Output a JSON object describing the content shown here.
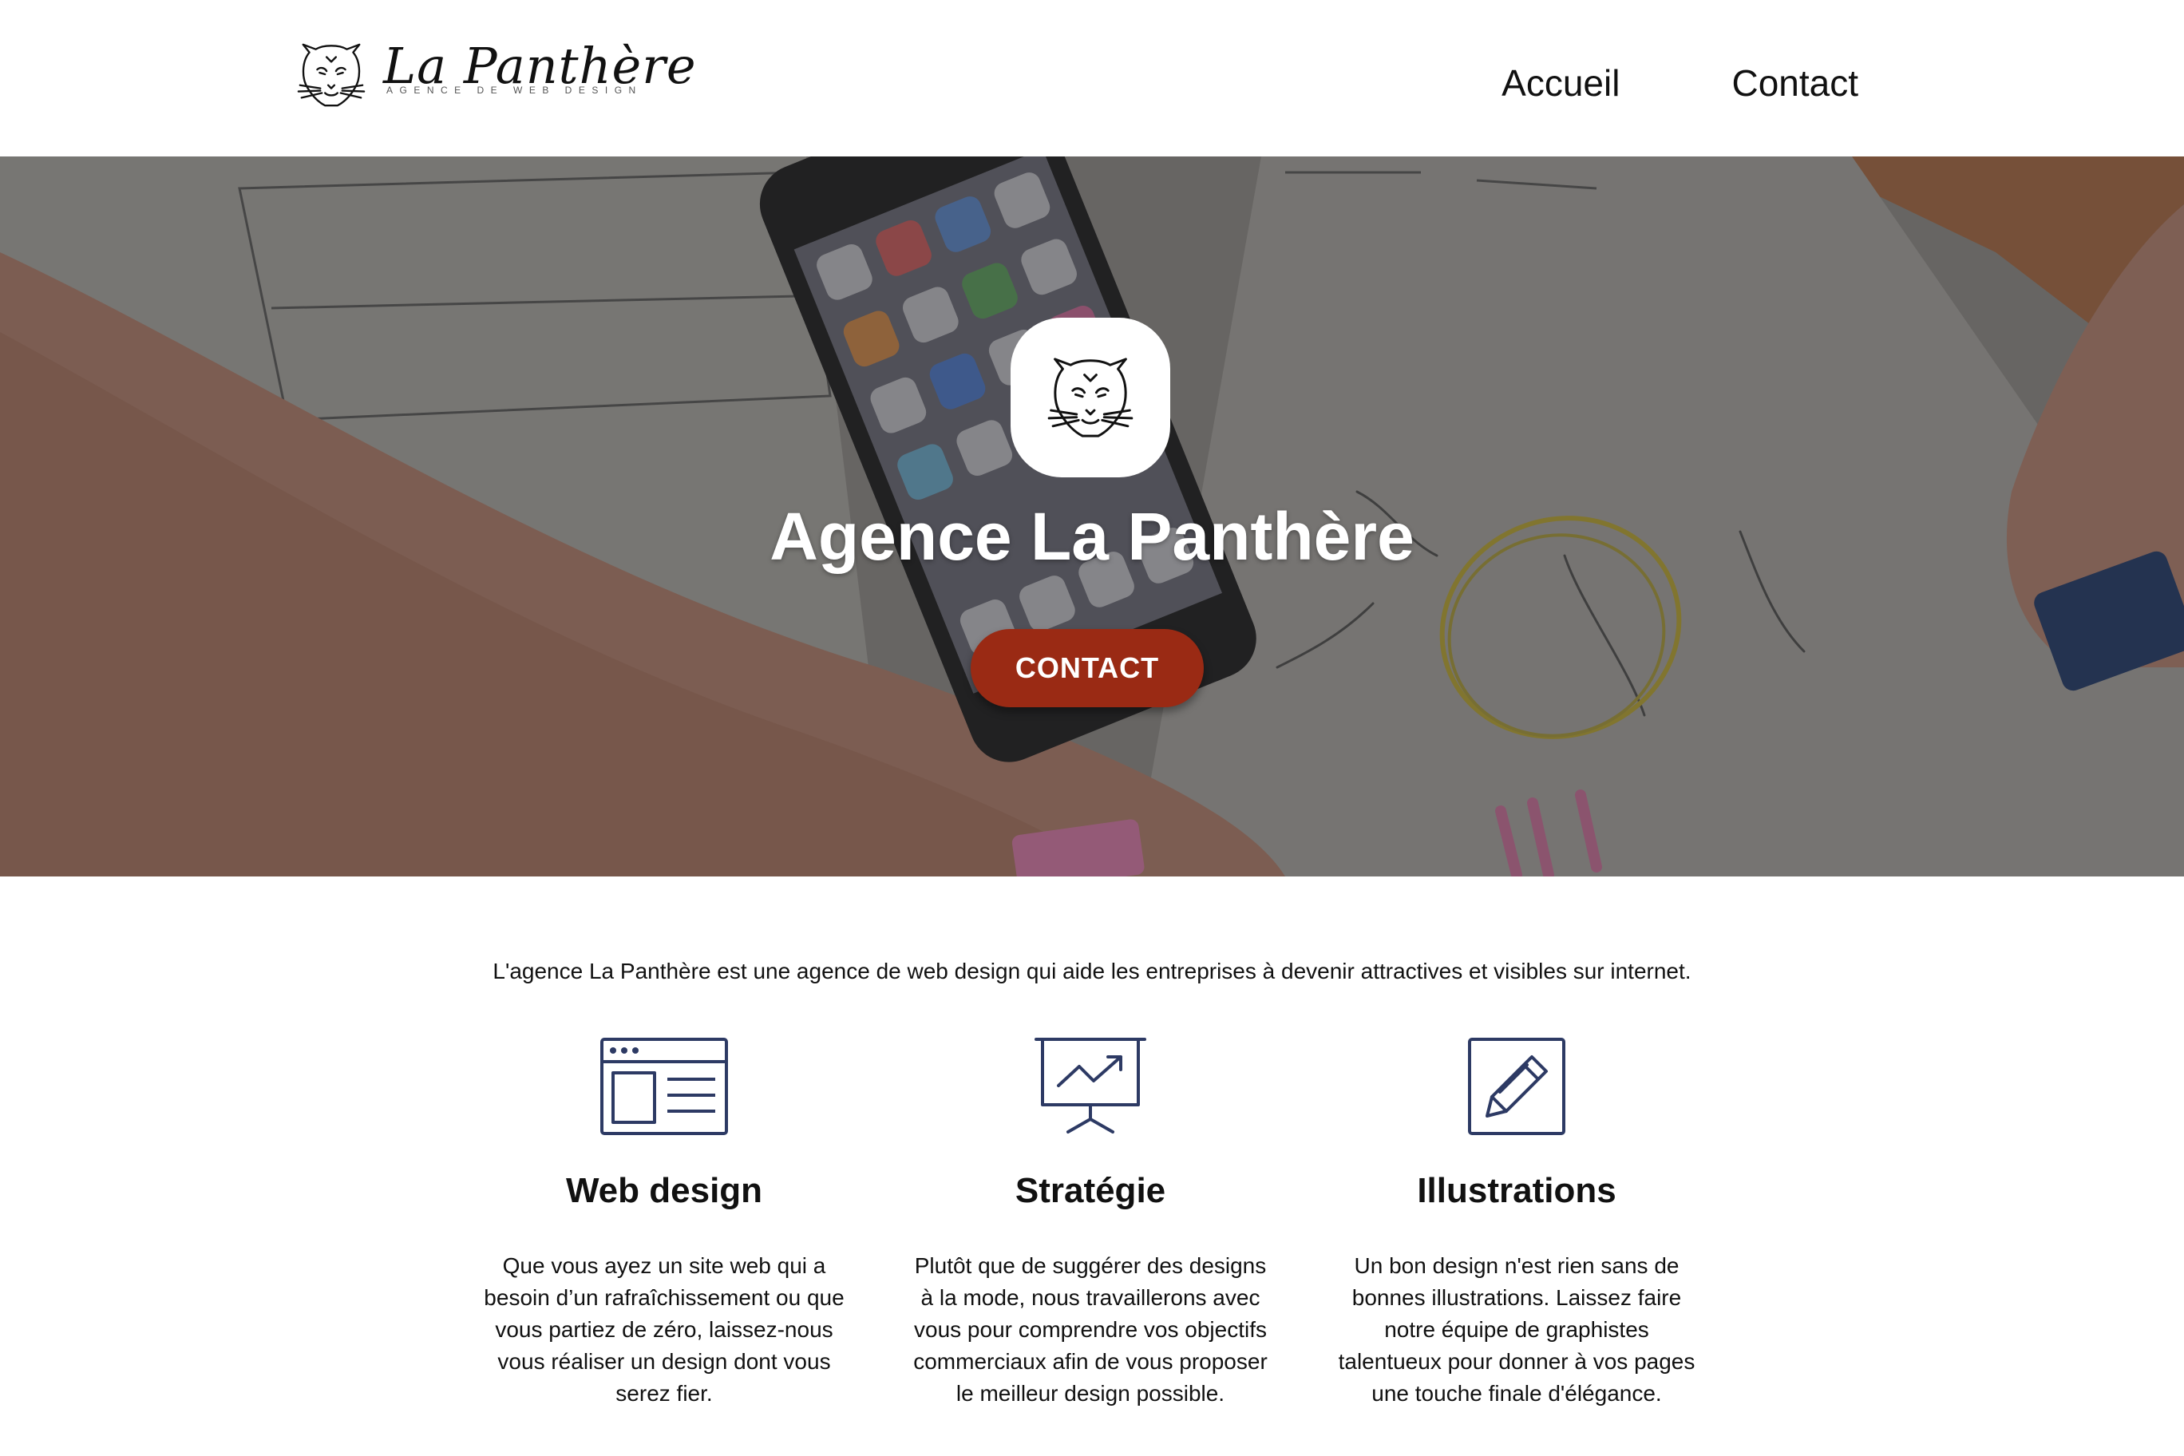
{
  "header": {
    "logo_name": "La Panthère",
    "logo_tagline": "AGENCE DE WEB DESIGN",
    "nav": [
      {
        "label": "Accueil"
      },
      {
        "label": "Contact"
      }
    ]
  },
  "hero": {
    "title": "Agence La Panthère",
    "cta_label": "CONTACT",
    "cta_color": "#9a2a14"
  },
  "intro": "L'agence La Panthère est une agence de web design qui aide les entreprises à devenir attractives et visibles sur internet.",
  "services": [
    {
      "icon": "browser-window-icon",
      "title": "Web design",
      "text": "Que vous ayez un site web qui a besoin d’un rafraîchissement ou que vous partiez de zéro, laissez-nous vous réaliser un design dont vous serez fier."
    },
    {
      "icon": "presentation-chart-icon",
      "title": "Stratégie",
      "text": "Plutôt que de suggérer des designs à la mode, nous travaillerons avec vous pour comprendre vos objectifs commerciaux afin de vous proposer le meilleur design possible."
    },
    {
      "icon": "pencil-edit-icon",
      "title": "Illustrations",
      "text": "Un bon design n'est rien sans de bonnes illustrations. Laissez faire notre équipe de graphistes talentueux pour donner à vos pages une touche finale d'élégance."
    }
  ],
  "colors": {
    "icon_stroke": "#2d3a64",
    "accent": "#9a2a14"
  }
}
